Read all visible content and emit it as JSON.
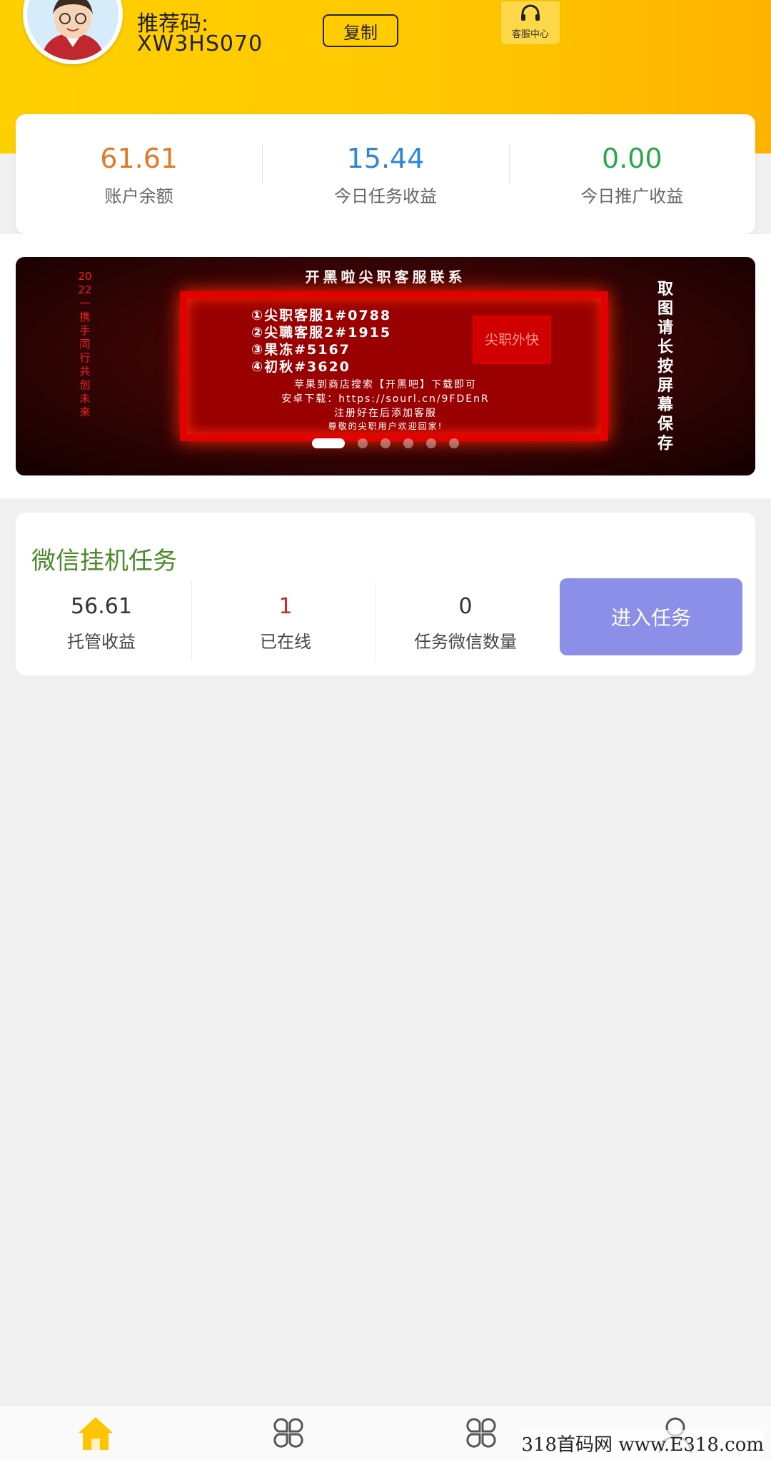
{
  "header": {
    "referral_label": "推荐码:",
    "referral_code": "XW3HS070",
    "copy_button": "复制",
    "customer_service_label": "客服中心"
  },
  "stats": [
    {
      "value": "61.61",
      "label": "账户余额",
      "color": "#e07a27"
    },
    {
      "value": "15.44",
      "label": "今日任务收益",
      "color": "#2e86d8"
    },
    {
      "value": "0.00",
      "label": "今日推广收益",
      "color": "#2aa84a"
    }
  ],
  "banner": {
    "title": "开黑啦尖职客服联系",
    "left_text": "2022一携手同行共创未来",
    "right_text": "取图请长按屏幕保存",
    "list": [
      "①尖职客服1#0788",
      "②尖職客服2#1915",
      "③果冻#5167",
      "④初秋#3620"
    ],
    "stamp": "尖职外快",
    "line1": "苹果到商店搜索【开黑吧】下载即可",
    "line2": "安卓下载：https://sourl.cn/9FDEnR",
    "line3": "注册好在后添加客服",
    "line4": "尊敬的尖职用户欢迎回家!",
    "slide_count": 6,
    "active_slide": 1
  },
  "task": {
    "title": "微信挂机任务",
    "stats": [
      {
        "value": "56.61",
        "label": "托管收益",
        "color": "#333333"
      },
      {
        "value": "1",
        "label": "已在线",
        "color": "#d32222"
      },
      {
        "value": "0",
        "label": "任务微信数量",
        "color": "#333333"
      }
    ],
    "enter_button": "进入任务"
  },
  "nav": {
    "items": [
      {
        "icon": "home-icon",
        "active": true
      },
      {
        "icon": "grid-icon",
        "active": false
      },
      {
        "icon": "grid-icon",
        "active": false
      },
      {
        "icon": "user-icon",
        "active": false
      }
    ]
  },
  "watermark": "318首码网 www.E318.com"
}
